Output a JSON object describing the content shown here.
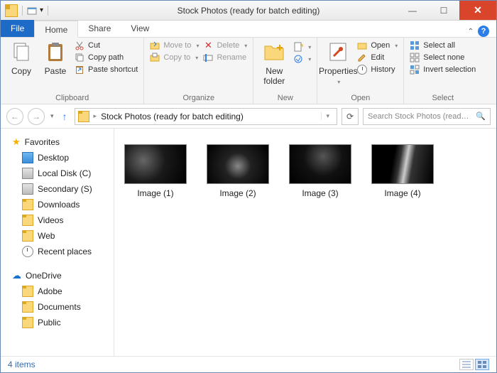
{
  "window": {
    "title": "Stock Photos (ready for batch editing)"
  },
  "tabs": {
    "file": "File",
    "home": "Home",
    "share": "Share",
    "view": "View"
  },
  "ribbon": {
    "clipboard": {
      "label": "Clipboard",
      "copy": "Copy",
      "paste": "Paste",
      "cut": "Cut",
      "copy_path": "Copy path",
      "paste_shortcut": "Paste shortcut"
    },
    "organize": {
      "label": "Organize",
      "move_to": "Move to",
      "copy_to": "Copy to",
      "delete": "Delete",
      "rename": "Rename"
    },
    "new": {
      "label": "New",
      "new_folder_line1": "New",
      "new_folder_line2": "folder"
    },
    "open": {
      "label": "Open",
      "properties": "Properties",
      "open": "Open",
      "edit": "Edit",
      "history": "History"
    },
    "select": {
      "label": "Select",
      "select_all": "Select all",
      "select_none": "Select none",
      "invert": "Invert selection"
    }
  },
  "addressbar": {
    "path": "Stock Photos (ready for batch editing)"
  },
  "search": {
    "placeholder": "Search Stock Photos (ready fo..."
  },
  "sidebar": {
    "favorites": "Favorites",
    "items": [
      {
        "label": "Desktop"
      },
      {
        "label": "Local Disk (C)"
      },
      {
        "label": "Secondary (S)"
      },
      {
        "label": "Downloads"
      },
      {
        "label": "Videos"
      },
      {
        "label": "Web"
      },
      {
        "label": "Recent places"
      }
    ],
    "onedrive": "OneDrive",
    "od_items": [
      {
        "label": "Adobe"
      },
      {
        "label": "Documents"
      },
      {
        "label": "Public"
      }
    ]
  },
  "files": [
    {
      "label": "Image (1)"
    },
    {
      "label": "Image (2)"
    },
    {
      "label": "Image (3)"
    },
    {
      "label": "Image (4)"
    }
  ],
  "status": {
    "count": "4 items"
  }
}
